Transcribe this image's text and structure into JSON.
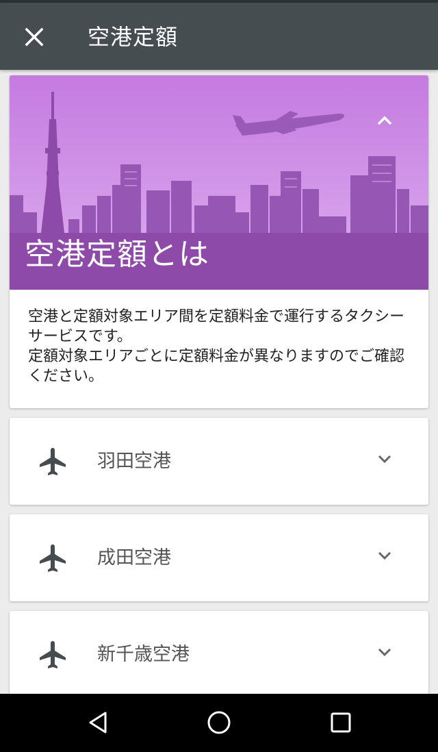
{
  "appbar": {
    "title": "空港定額",
    "close_icon": "close-icon"
  },
  "hero": {
    "title": "空港定額とは",
    "paragraph1": "空港と定額対象エリア間を定額料金で運行するタクシーサービスです。",
    "paragraph2": "定額対象エリアごとに定額料金が異なりますのでご確認ください。",
    "banner_colors": {
      "sky_top": "#c77fe0",
      "sky_bottom": "#d9a6ee",
      "city": "#9a5ab8",
      "ground": "#8e4aa8"
    }
  },
  "airports": [
    {
      "name": "羽田空港",
      "icon": "airplane-icon"
    },
    {
      "name": "成田空港",
      "icon": "airplane-icon"
    },
    {
      "name": "新千歳空港",
      "icon": "airplane-icon"
    }
  ],
  "navbar": {
    "back": "back-triangle-icon",
    "home": "home-circle-icon",
    "recents": "recents-square-icon"
  }
}
